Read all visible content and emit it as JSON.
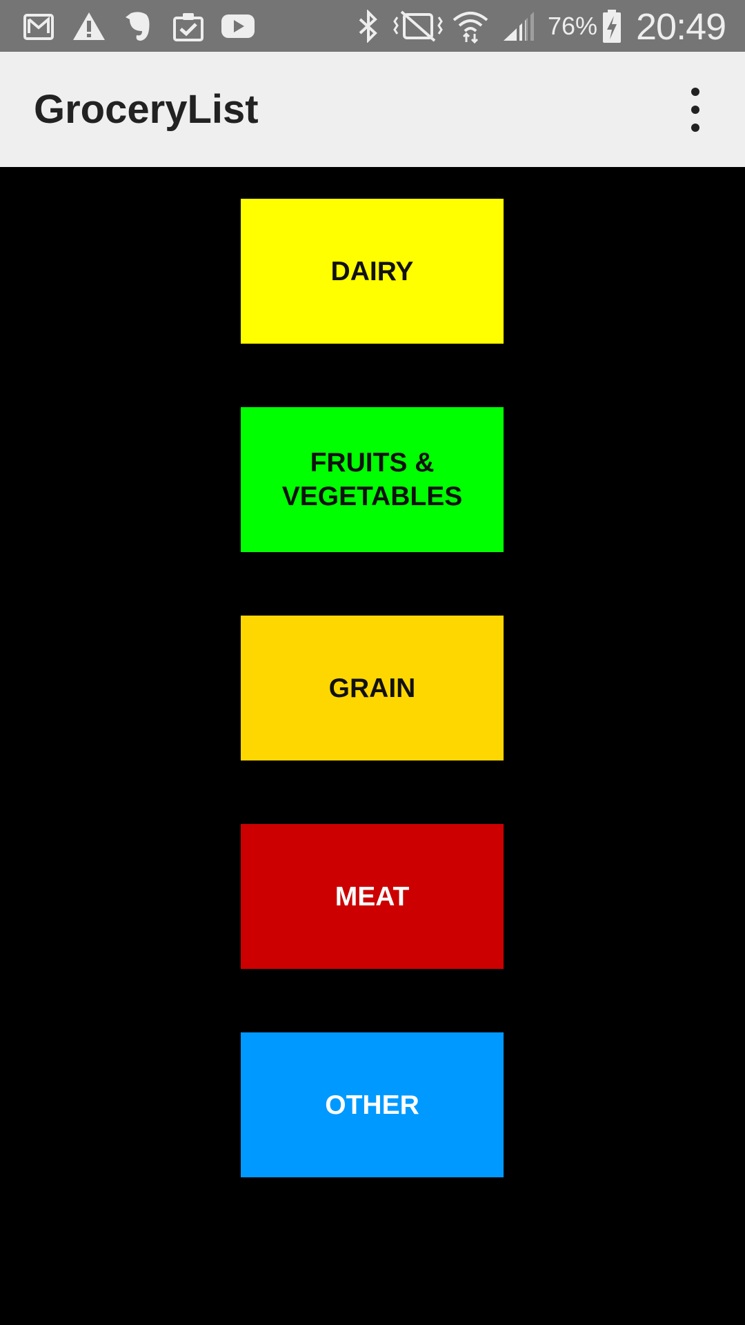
{
  "status_bar": {
    "icons": [
      "gmail-icon",
      "warning-icon",
      "evernote-icon",
      "clipboard-check-icon",
      "youtube-icon",
      "bluetooth-icon",
      "vibrate-icon",
      "wifi-icon",
      "cell-signal-icon",
      "battery-charging-icon"
    ],
    "battery_percent": "76%",
    "time": "20:49"
  },
  "app_bar": {
    "title": "GroceryList",
    "menu_icon": "overflow-menu-icon"
  },
  "categories": [
    {
      "label": "DAIRY",
      "color": "#ffff00",
      "text_color": "#111111"
    },
    {
      "label_lines": [
        "FRUITS &",
        "VEGETABLES"
      ],
      "color": "#00ff00",
      "text_color": "#111111"
    },
    {
      "label": "GRAIN",
      "color": "#ffd700",
      "text_color": "#111111"
    },
    {
      "label": "MEAT",
      "color": "#cc0000",
      "text_color": "#ffffff"
    },
    {
      "label": "OTHER",
      "color": "#0099ff",
      "text_color": "#ffffff"
    }
  ]
}
